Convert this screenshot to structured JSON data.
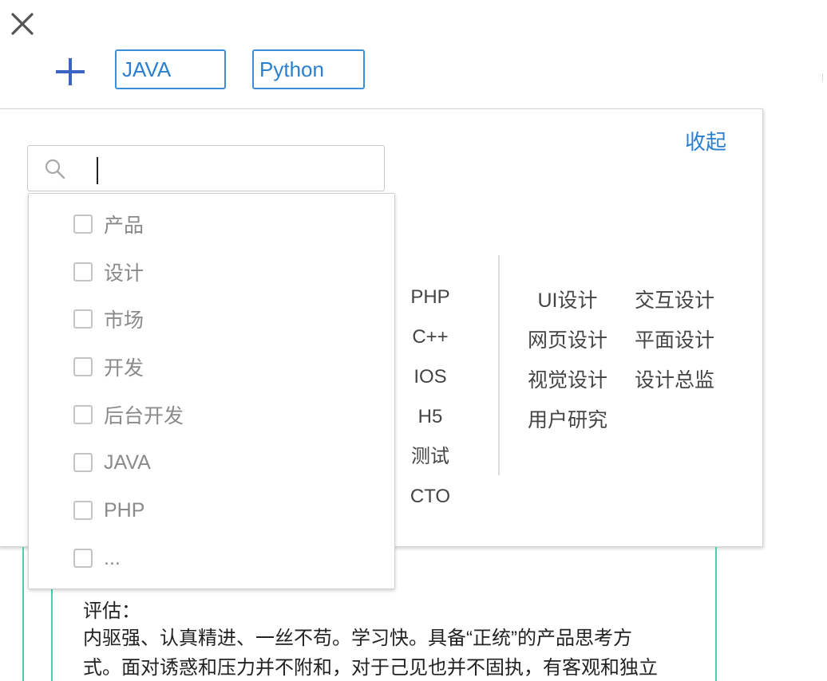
{
  "tags": [
    "JAVA",
    "Python"
  ],
  "card": {
    "collapse_label": "收起"
  },
  "search": {
    "value": ""
  },
  "dropdown": {
    "items": [
      "产品",
      "设计",
      "市场",
      "开发",
      "后台开发",
      "JAVA",
      "PHP",
      "..."
    ]
  },
  "options_mid": [
    "PHP",
    "C++",
    "IOS",
    "H5",
    "测试",
    "CTO"
  ],
  "options_right": [
    [
      "UI设计",
      "交互设计"
    ],
    [
      "网页设计",
      "平面设计"
    ],
    [
      "视觉设计",
      "设计总监"
    ],
    [
      "用户研究",
      ""
    ]
  ],
  "evaluation": {
    "label": "评估：",
    "line1": "内驱强、认真精进、一丝不苟。学习快。具备“正统”的产品思考方",
    "line2": "式。面对诱惑和压力并不附和，对于己见也并不固执，有客观和独立"
  },
  "colors": {
    "accent": "#2a7fce",
    "teal": "#45d0b0",
    "checkbox_border": "#c4c4c4"
  },
  "icons": [
    "close-icon",
    "plus-icon",
    "search-icon"
  ]
}
